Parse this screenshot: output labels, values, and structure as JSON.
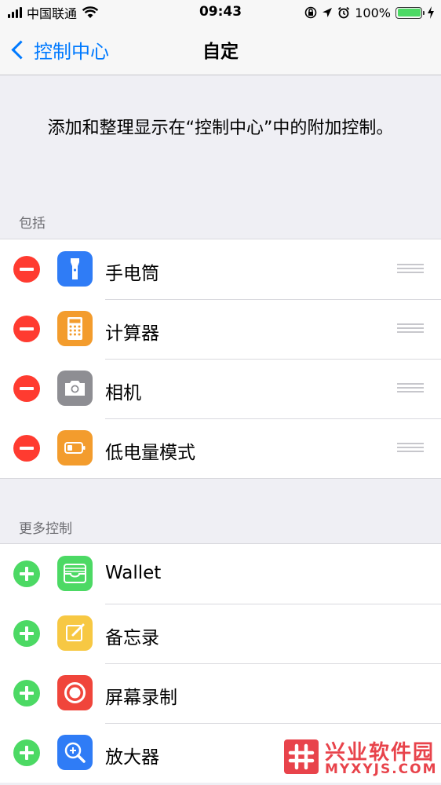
{
  "status_bar": {
    "carrier": "中国联通",
    "time": "09:43",
    "battery_percent": "100%",
    "icons": [
      "signal-icon",
      "wifi-icon",
      "rotation-lock-icon",
      "location-icon",
      "alarm-icon",
      "battery-icon",
      "charging-icon"
    ]
  },
  "nav": {
    "back_label": "控制中心",
    "title": "自定"
  },
  "description": "添加和整理显示在“控制中心”中的附加控制。",
  "included": {
    "header": "包括",
    "items": [
      {
        "label": "手电筒",
        "icon": "flashlight-icon",
        "color": "#2f7cf6"
      },
      {
        "label": "计算器",
        "icon": "calculator-icon",
        "color": "#f39c2d"
      },
      {
        "label": "相机",
        "icon": "camera-icon",
        "color": "#8e8e93"
      },
      {
        "label": "低电量模式",
        "icon": "low-power-icon",
        "color": "#f39c2d"
      }
    ]
  },
  "more": {
    "header": "更多控制",
    "items": [
      {
        "label": "Wallet",
        "icon": "wallet-icon",
        "color": "#4cd964"
      },
      {
        "label": "备忘录",
        "icon": "notes-icon",
        "color": "#f7c843"
      },
      {
        "label": "屏幕录制",
        "icon": "screen-record-icon",
        "color": "#f0453b"
      },
      {
        "label": "放大器",
        "icon": "magnifier-icon",
        "color": "#2f7cf6"
      }
    ]
  },
  "watermark": {
    "title": "兴业软件园",
    "subtitle": "MYXYJS.COM"
  }
}
